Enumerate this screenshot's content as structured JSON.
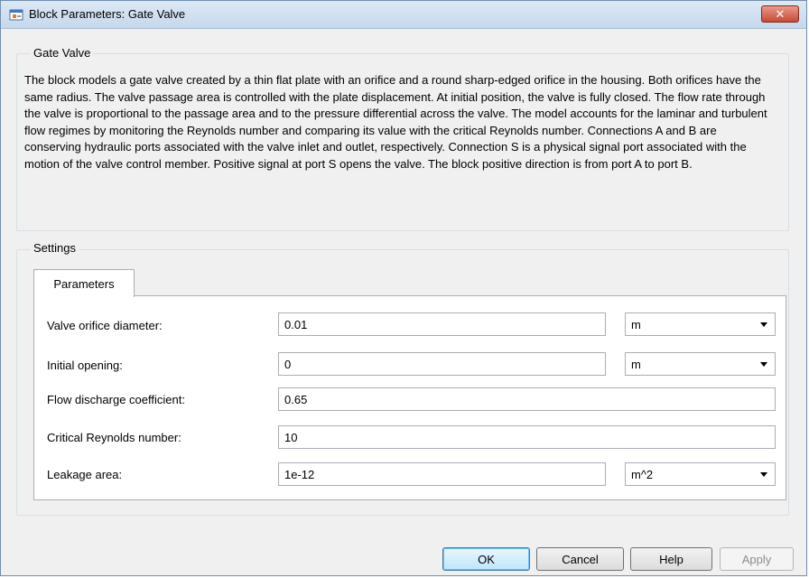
{
  "window": {
    "title": "Block Parameters: Gate Valve",
    "close_glyph": "✕",
    "icon": "simulink-block-icon"
  },
  "description_group": {
    "title": "Gate Valve",
    "text": "The block models a gate valve created by a thin flat plate with an orifice and a round sharp-edged orifice in the housing. Both orifices have the same radius. The valve passage area is controlled with the plate displacement. At initial position, the valve is fully closed. The flow rate through the valve is proportional to the passage area and to the pressure differential across the valve. The model accounts for the laminar and turbulent flow regimes by monitoring the Reynolds number and comparing its value with the critical Reynolds number. Connections A and B are conserving hydraulic ports associated with the valve inlet and outlet, respectively. Connection S is a physical signal port associated with the motion of the valve control member. Positive signal at port S opens the valve. The block positive direction is from port A to port B."
  },
  "settings": {
    "title": "Settings",
    "tab_label": "Parameters",
    "params": [
      {
        "label": "Valve orifice diameter:",
        "value": "0.01",
        "unit": "m"
      },
      {
        "label": "Initial opening:",
        "value": "0",
        "unit": "m"
      },
      {
        "label": "Flow discharge coefficient:",
        "value": "0.65",
        "unit": null
      },
      {
        "label": "Critical Reynolds number:",
        "value": "10",
        "unit": null
      },
      {
        "label": "Leakage area:",
        "value": "1e-12",
        "unit": "m^2"
      }
    ]
  },
  "buttons": {
    "ok": "OK",
    "cancel": "Cancel",
    "help": "Help",
    "apply": "Apply"
  }
}
